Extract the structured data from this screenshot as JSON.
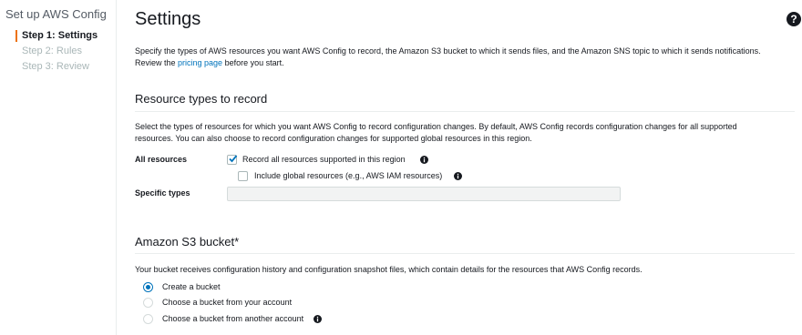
{
  "sidebar": {
    "title": "Set up AWS Config",
    "steps": [
      {
        "label": "Step 1: Settings",
        "active": true
      },
      {
        "label": "Step 2: Rules",
        "active": false
      },
      {
        "label": "Step 3: Review",
        "active": false
      }
    ]
  },
  "page": {
    "title": "Settings",
    "help_icon": "question-circle-icon",
    "intro_line1": "Specify the types of AWS resources you want AWS Config to record, the Amazon S3 bucket to which it sends files, and the Amazon SNS topic to which it sends notifications.",
    "intro_line2_prefix": "Review the ",
    "intro_link": "pricing page",
    "intro_line2_suffix": " before you start."
  },
  "resource_types": {
    "title": "Resource types to record",
    "desc_line1": "Select the types of resources for which you want AWS Config to record configuration changes. By default, AWS Config records configuration changes for all supported",
    "desc_line2": "resources. You can also choose to record configuration changes for supported global resources in this region.",
    "all_resources_label": "All resources",
    "record_all": {
      "label": "Record all resources supported in this region",
      "checked": true
    },
    "include_global": {
      "label": "Include global resources (e.g., AWS IAM resources)",
      "checked": false
    },
    "specific_types_label": "Specific types",
    "specific_types_value": ""
  },
  "s3": {
    "title": "Amazon S3 bucket*",
    "desc": "Your bucket receives configuration history and configuration snapshot files, which contain details for the resources that AWS Config records.",
    "options": [
      {
        "label": "Create a bucket",
        "selected": true
      },
      {
        "label": "Choose a bucket from your account",
        "selected": false
      },
      {
        "label": "Choose a bucket from another account",
        "selected": false
      }
    ]
  },
  "colors": {
    "accent": "#ec7211",
    "link": "#0073bb"
  }
}
